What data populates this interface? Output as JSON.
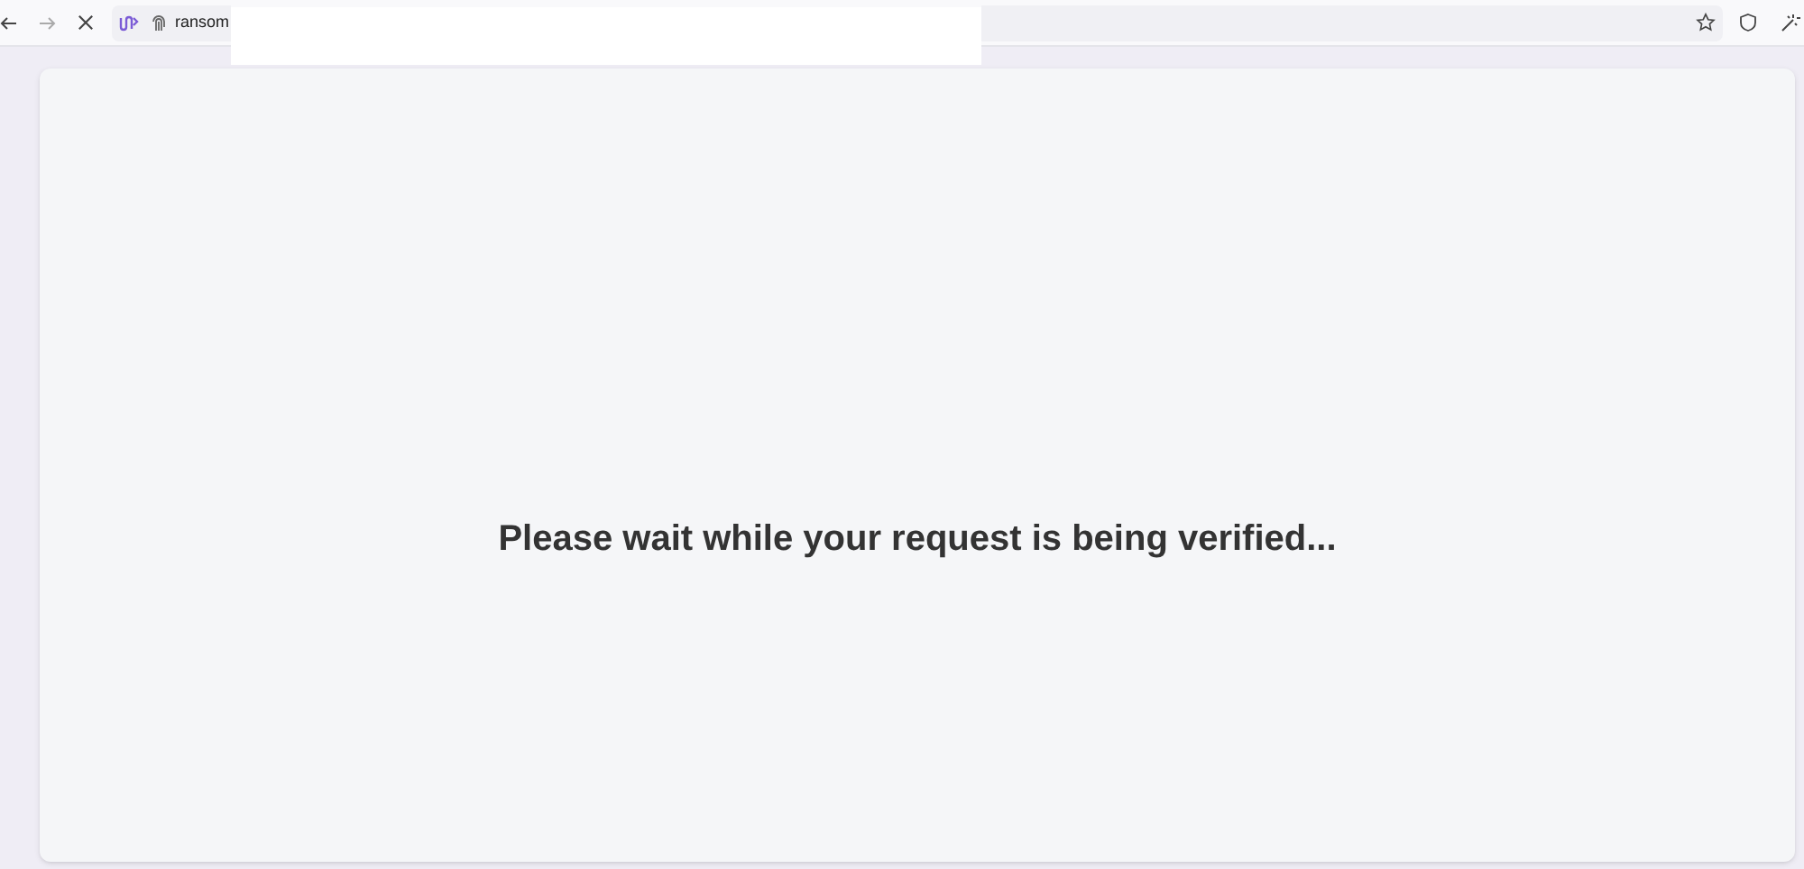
{
  "toolbar": {
    "url": "ransom"
  },
  "page": {
    "message": "Please wait while your request is being verified..."
  }
}
